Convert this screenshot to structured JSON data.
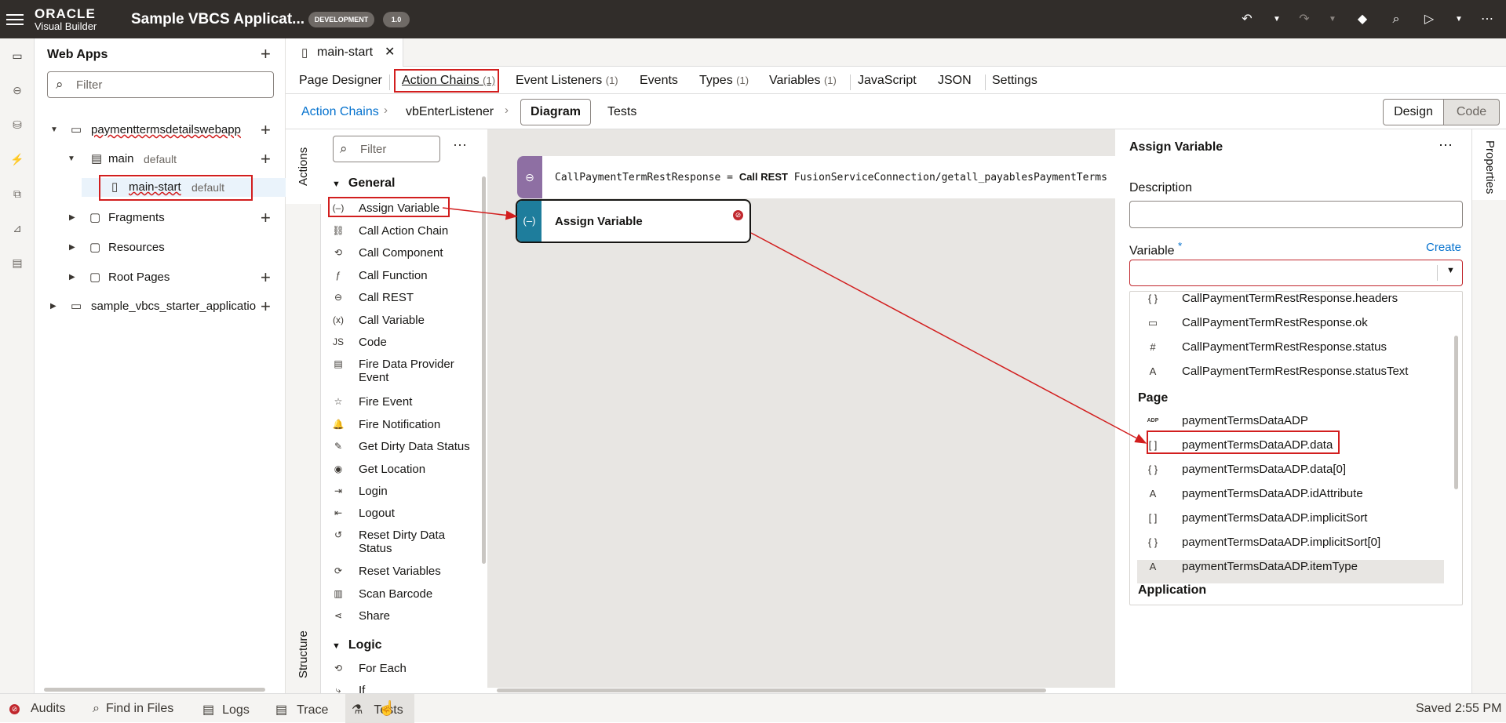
{
  "header": {
    "logo_line1": "ORACLE",
    "logo_line2": "Visual Builder",
    "app_name": "Sample VBCS Applicat...",
    "env_badge": "DEVELOPMENT",
    "version_badge": "1.0"
  },
  "webapps": {
    "title": "Web Apps",
    "filter_placeholder": "Filter",
    "tree": {
      "app": "paymenttermsdetailswebapp",
      "flow": "main",
      "flow_tag": "default",
      "page": "main-start",
      "page_tag": "default",
      "fragments": "Fragments",
      "resources": "Resources",
      "root_pages": "Root Pages",
      "other_app": "sample_vbcs_starter_applicatio"
    }
  },
  "file_tab": {
    "label": "main-start"
  },
  "editor_tabs": [
    {
      "label": "Page Designer",
      "count": ""
    },
    {
      "label": "Action Chains",
      "count": "(1)"
    },
    {
      "label": "Event Listeners",
      "count": "(1)"
    },
    {
      "label": "Events",
      "count": ""
    },
    {
      "label": "Types",
      "count": "(1)"
    },
    {
      "label": "Variables",
      "count": "(1)"
    },
    {
      "label": "JavaScript",
      "count": ""
    },
    {
      "label": "JSON",
      "count": ""
    },
    {
      "label": "Settings",
      "count": ""
    }
  ],
  "subbar": {
    "crumb_root": "Action Chains",
    "crumb_chain": "vbEnterListener",
    "diagram": "Diagram",
    "tests": "Tests",
    "design": "Design",
    "code": "Code"
  },
  "actions_panel": {
    "strip_label": "Actions",
    "structure_label": "Structure",
    "filter_placeholder": "Filter",
    "general": "General",
    "logic": "Logic",
    "items": [
      {
        "icon": "(–)",
        "label": "Assign Variable"
      },
      {
        "icon": "⛓",
        "label": "Call Action Chain"
      },
      {
        "icon": "⟲",
        "label": "Call Component"
      },
      {
        "icon": "ƒ",
        "label": "Call Function"
      },
      {
        "icon": "⊖",
        "label": "Call REST"
      },
      {
        "icon": "(x)",
        "label": "Call Variable"
      },
      {
        "icon": "JS",
        "label": "Code"
      },
      {
        "icon": "▤",
        "label": "Fire Data Provider Event"
      },
      {
        "icon": "☆",
        "label": "Fire Event"
      },
      {
        "icon": "🔔",
        "label": "Fire Notification"
      },
      {
        "icon": "✎",
        "label": "Get Dirty Data Status"
      },
      {
        "icon": "◉",
        "label": "Get Location"
      },
      {
        "icon": "⇥",
        "label": "Login"
      },
      {
        "icon": "⇤",
        "label": "Logout"
      },
      {
        "icon": "↺",
        "label": "Reset Dirty Data Status"
      },
      {
        "icon": "⟳",
        "label": "Reset Variables"
      },
      {
        "icon": "▥",
        "label": "Scan Barcode"
      },
      {
        "icon": "⋖",
        "label": "Share"
      }
    ],
    "logic_items": [
      {
        "icon": "⟲",
        "label": "For Each"
      },
      {
        "icon": "⤷",
        "label": "If"
      }
    ]
  },
  "canvas": {
    "node1_var": "CallPaymentTermRestResponse",
    "node1_eq": "=",
    "node1_call": "Call REST",
    "node1_target": "FusionServiceConnection/getall_payablesPaymentTerms",
    "node2_label": "Assign Variable"
  },
  "properties": {
    "title": "Assign Variable",
    "strip_label": "Properties",
    "description_label": "Description",
    "variable_label": "Variable",
    "required_mark": "*",
    "create_link": "Create",
    "options_top": [
      {
        "icon": "{ }",
        "label": "CallPaymentTermRestResponse.headers"
      },
      {
        "icon": "▭",
        "label": "CallPaymentTermRestResponse.ok"
      },
      {
        "icon": "#",
        "label": "CallPaymentTermRestResponse.status"
      },
      {
        "icon": "A",
        "label": "CallPaymentTermRestResponse.statusText"
      }
    ],
    "group_page": "Page",
    "options_page": [
      {
        "icon": "ADP",
        "label": "paymentTermsDataADP"
      },
      {
        "icon": "[ ]",
        "label": "paymentTermsDataADP.data"
      },
      {
        "icon": "{ }",
        "label": "paymentTermsDataADP.data[0]"
      },
      {
        "icon": "A",
        "label": "paymentTermsDataADP.idAttribute"
      },
      {
        "icon": "[ ]",
        "label": "paymentTermsDataADP.implicitSort"
      },
      {
        "icon": "{ }",
        "label": "paymentTermsDataADP.implicitSort[0]"
      },
      {
        "icon": "A",
        "label": "paymentTermsDataADP.itemType"
      }
    ],
    "group_application": "Application"
  },
  "bottom": {
    "audits": "Audits",
    "find": "Find in Files",
    "logs": "Logs",
    "trace": "Trace",
    "tests": "Tests",
    "saved": "Saved 2:55 PM"
  },
  "colors": {
    "accent": "#0572ce",
    "highlight": "#d21e1e",
    "topbar": "#312d2a"
  }
}
